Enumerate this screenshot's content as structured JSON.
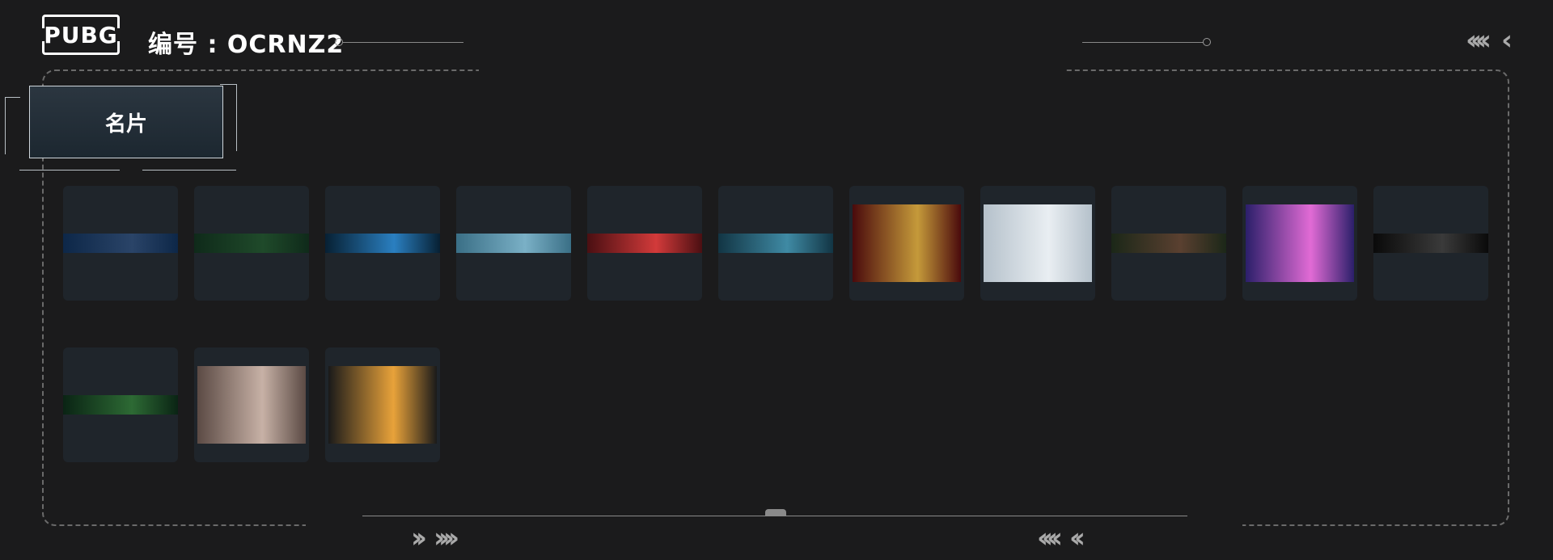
{
  "header": {
    "logo_text": "PUBG",
    "player_id": "编号 : OCRNZ2"
  },
  "section": {
    "title": "名片"
  },
  "cards": [
    {
      "name": "moon-phases-card",
      "kind": "strip",
      "colors": [
        "#0d2748",
        "#2a4468"
      ]
    },
    {
      "name": "green-camo-card",
      "kind": "strip",
      "colors": [
        "#0f2a1a",
        "#1f4a2a"
      ]
    },
    {
      "name": "blue-beam-card",
      "kind": "strip",
      "colors": [
        "#072033",
        "#2a7fc0"
      ]
    },
    {
      "name": "mountain-landscape-card",
      "kind": "strip",
      "colors": [
        "#3a6f86",
        "#7ab0c6"
      ]
    },
    {
      "name": "red-dragon-card",
      "kind": "strip",
      "colors": [
        "#4a0f12",
        "#d23a3a"
      ]
    },
    {
      "name": "wolf-head-card",
      "kind": "strip",
      "colors": [
        "#123544",
        "#3f8aa4"
      ]
    },
    {
      "name": "bullet-card",
      "kind": "pic",
      "colors": [
        "#4a0a0c",
        "#c59a3a"
      ]
    },
    {
      "name": "figure-skater-card",
      "kind": "pic",
      "colors": [
        "#b5c1cb",
        "#e9eef2"
      ]
    },
    {
      "name": "shark-jaw-card",
      "kind": "strip",
      "colors": [
        "#1b2718",
        "#5a4030"
      ]
    },
    {
      "name": "neon-speed-card",
      "kind": "pic",
      "colors": [
        "#2b1f6a",
        "#e16bd5"
      ]
    },
    {
      "name": "dark-spikes-card",
      "kind": "strip",
      "colors": [
        "#0a0a0a",
        "#3a3a3a"
      ]
    },
    {
      "name": "jungle-eye-card",
      "kind": "strip",
      "colors": [
        "#0a2414",
        "#2d6a34"
      ]
    },
    {
      "name": "smoking-woman-card",
      "kind": "pic",
      "colors": [
        "#5b4a44",
        "#c7b1a6"
      ]
    },
    {
      "name": "skull-helmet-card",
      "kind": "pic",
      "colors": [
        "#1a1a1a",
        "#e8a23a"
      ]
    }
  ],
  "accent_colors": {
    "frame": "#6a6a6a",
    "title_box": "#2b3640",
    "chevron": "#aaaaaa"
  }
}
